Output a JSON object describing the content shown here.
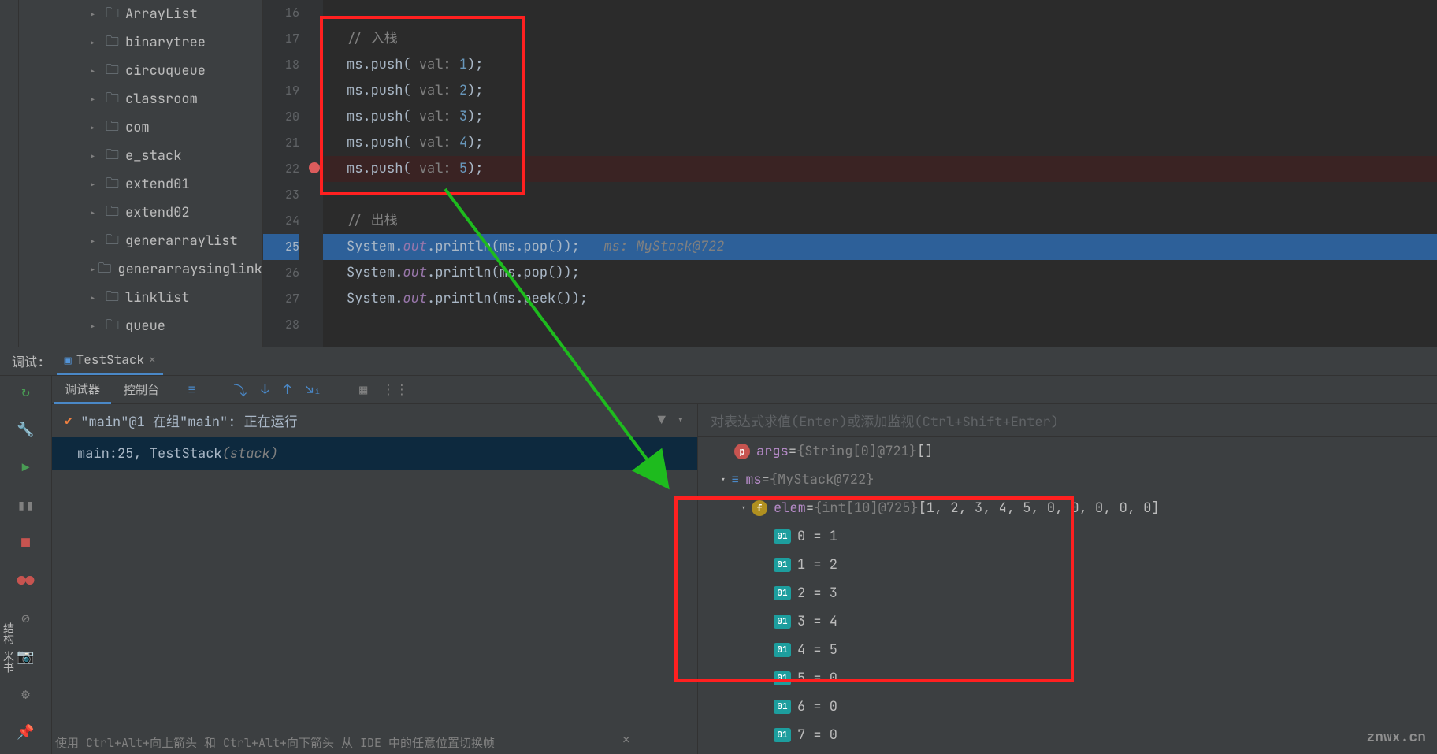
{
  "tree": {
    "items": [
      {
        "label": "ArrayList"
      },
      {
        "label": "binarytree"
      },
      {
        "label": "circuqueue"
      },
      {
        "label": "classroom"
      },
      {
        "label": "com"
      },
      {
        "label": "e_stack"
      },
      {
        "label": "extend01"
      },
      {
        "label": "extend02"
      },
      {
        "label": "generarraylist"
      },
      {
        "label": "generarraysinglink"
      },
      {
        "label": "linklist"
      },
      {
        "label": "queue"
      }
    ]
  },
  "editor": {
    "lines": [
      "16",
      "17",
      "18",
      "19",
      "20",
      "21",
      "22",
      "23",
      "24",
      "25",
      "26",
      "27",
      "28"
    ],
    "breakpoint_line": "22",
    "exec_line": "25",
    "code": {
      "comment1": "// 入栈",
      "push": {
        "obj": "ms.push( ",
        "param": "val: ",
        "close": ");"
      },
      "push_vals": [
        "1",
        "2",
        "3",
        "4",
        "5"
      ],
      "comment2": "// 出栈",
      "sout_pop": "System.",
      "out": "out",
      "println_pop": ".println(ms.pop());",
      "println_peek": ".println(ms.peek());",
      "hint": "   ms: MyStack@722"
    }
  },
  "debug": {
    "title": "调试:",
    "tab": "TestStack",
    "subtabs": {
      "debugger": "调试器",
      "console": "控制台"
    },
    "thread": {
      "text": "\"main\"@1 在组\"main\": 正在运行"
    },
    "frame": {
      "label": "main:25, TestStack ",
      "suffix": "(stack)"
    },
    "watch_placeholder": "对表达式求值(Enter)或添加监视(Ctrl+Shift+Enter)",
    "vars": {
      "args": {
        "name": "args",
        "type": "{String[0]@721}",
        "val": " []"
      },
      "ms": {
        "name": "ms",
        "type": "{MyStack@722}"
      },
      "elem": {
        "name": "elem",
        "type": "{int[10]@725}",
        "val": " [1, 2, 3, 4, 5, 0, 0, 0, 0, 0]"
      },
      "items": [
        {
          "k": "0",
          "v": "1"
        },
        {
          "k": "1",
          "v": "2"
        },
        {
          "k": "2",
          "v": "3"
        },
        {
          "k": "3",
          "v": "4"
        },
        {
          "k": "4",
          "v": "5"
        },
        {
          "k": "5",
          "v": "0"
        },
        {
          "k": "6",
          "v": "0"
        },
        {
          "k": "7",
          "v": "0"
        }
      ]
    }
  },
  "statusbar": "使用 Ctrl+Alt+向上箭头 和 Ctrl+Alt+向下箭头 从 IDE 中的任意位置切换帧",
  "watermark": "znwx.cn",
  "side": "结构  米书"
}
